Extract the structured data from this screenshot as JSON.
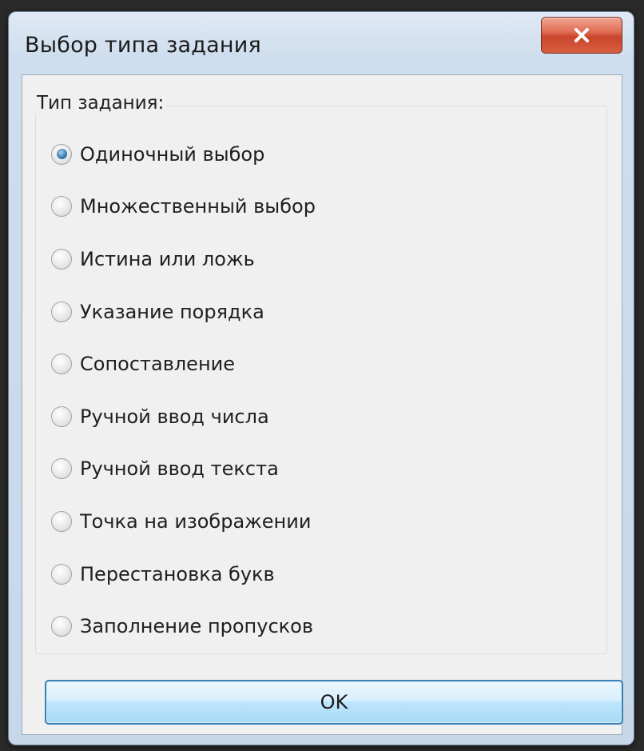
{
  "window": {
    "title": "Выбор типа задания"
  },
  "group": {
    "legend": "Тип задания:"
  },
  "options": [
    {
      "label": "Одиночный выбор",
      "selected": true
    },
    {
      "label": "Множественный выбор",
      "selected": false
    },
    {
      "label": "Истина или ложь",
      "selected": false
    },
    {
      "label": "Указание порядка",
      "selected": false
    },
    {
      "label": "Сопоставление",
      "selected": false
    },
    {
      "label": "Ручной ввод числа",
      "selected": false
    },
    {
      "label": "Ручной ввод текста",
      "selected": false
    },
    {
      "label": "Точка на изображении",
      "selected": false
    },
    {
      "label": "Перестановка букв",
      "selected": false
    },
    {
      "label": "Заполнение пропусков",
      "selected": false
    }
  ],
  "buttons": {
    "ok_label": "OK"
  },
  "icons": {
    "close": "close-icon"
  },
  "colors": {
    "close_button": "#d9573a",
    "ok_border": "#3c7fb1",
    "client_bg": "#f0f0f0"
  }
}
